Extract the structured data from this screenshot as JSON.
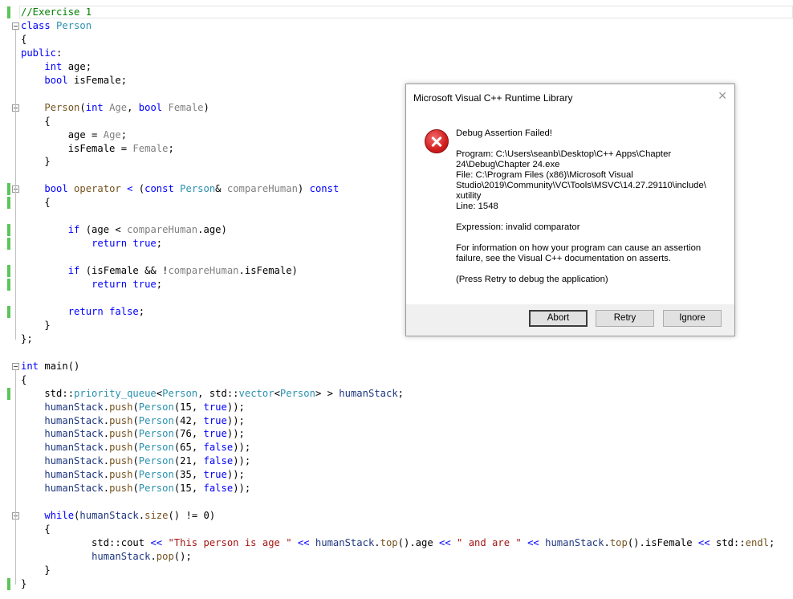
{
  "code": {
    "lines": [
      [
        [
          "cm",
          "//Exercise 1"
        ]
      ],
      [
        [
          "kw",
          "class "
        ],
        [
          "ty",
          "Person"
        ]
      ],
      [
        [
          "",
          "{"
        ]
      ],
      [
        [
          "kw",
          "public"
        ],
        [
          "",
          ":"
        ]
      ],
      [
        [
          "",
          "    "
        ],
        [
          "kw",
          "int "
        ],
        [
          "",
          "age;"
        ]
      ],
      [
        [
          "",
          "    "
        ],
        [
          "kw",
          "bool "
        ],
        [
          "",
          "isFemale;"
        ]
      ],
      [
        [
          "",
          ""
        ]
      ],
      [
        [
          "",
          "    "
        ],
        [
          "fn",
          "Person"
        ],
        [
          "",
          "("
        ],
        [
          "kw",
          "int "
        ],
        [
          "pa",
          "Age"
        ],
        [
          "",
          ", "
        ],
        [
          "kw",
          "bool "
        ],
        [
          "pa",
          "Female"
        ],
        [
          "",
          ")"
        ]
      ],
      [
        [
          "",
          "    {"
        ]
      ],
      [
        [
          "",
          "        age = "
        ],
        [
          "pa",
          "Age"
        ],
        [
          "",
          ";"
        ]
      ],
      [
        [
          "",
          "        isFemale = "
        ],
        [
          "pa",
          "Female"
        ],
        [
          "",
          ";"
        ]
      ],
      [
        [
          "",
          "    }"
        ]
      ],
      [
        [
          "",
          ""
        ]
      ],
      [
        [
          "",
          "    "
        ],
        [
          "kw",
          "bool "
        ],
        [
          "fn",
          "operator"
        ],
        [
          "",
          ""
        ],
        [
          "kw",
          " < "
        ],
        [
          "",
          "("
        ],
        [
          "kw",
          "const "
        ],
        [
          "ty",
          "Person"
        ],
        [
          "",
          "& "
        ],
        [
          "pa",
          "compareHuman"
        ],
        [
          "",
          ") "
        ],
        [
          "kw",
          "const"
        ]
      ],
      [
        [
          "",
          "    {"
        ]
      ],
      [
        [
          "",
          ""
        ]
      ],
      [
        [
          "",
          "        "
        ],
        [
          "kw",
          "if "
        ],
        [
          "",
          "(age < "
        ],
        [
          "pa",
          "compareHuman"
        ],
        [
          "",
          ".age)"
        ]
      ],
      [
        [
          "",
          "            "
        ],
        [
          "kw",
          "return true"
        ],
        [
          "",
          ";"
        ]
      ],
      [
        [
          "",
          ""
        ]
      ],
      [
        [
          "",
          "        "
        ],
        [
          "kw",
          "if "
        ],
        [
          "",
          "(isFemale && !"
        ],
        [
          "pa",
          "compareHuman"
        ],
        [
          "",
          ".isFemale)"
        ]
      ],
      [
        [
          "",
          "            "
        ],
        [
          "kw",
          "return true"
        ],
        [
          "",
          ";"
        ]
      ],
      [
        [
          "",
          ""
        ]
      ],
      [
        [
          "",
          "        "
        ],
        [
          "kw",
          "return false"
        ],
        [
          "",
          ";"
        ]
      ],
      [
        [
          "",
          "    }"
        ]
      ],
      [
        [
          "",
          "};"
        ]
      ],
      [
        [
          "",
          ""
        ]
      ],
      [
        [
          "kw",
          "int "
        ],
        [
          "",
          "main()"
        ]
      ],
      [
        [
          "",
          "{"
        ]
      ],
      [
        [
          "",
          "    std::"
        ],
        [
          "ty",
          "priority_queue"
        ],
        [
          "",
          "<"
        ],
        [
          "ty",
          "Person"
        ],
        [
          "",
          ", std::"
        ],
        [
          "ty",
          "vector"
        ],
        [
          "",
          "<"
        ],
        [
          "ty",
          "Person"
        ],
        [
          "",
          "> > "
        ],
        [
          "lo",
          "humanStack"
        ],
        [
          "",
          ";"
        ]
      ],
      [
        [
          "",
          "    "
        ],
        [
          "lo",
          "humanStack"
        ],
        [
          "",
          "."
        ],
        [
          "fn",
          "push"
        ],
        [
          "",
          "("
        ],
        [
          "ty",
          "Person"
        ],
        [
          "",
          "(15, "
        ],
        [
          "kw",
          "true"
        ],
        [
          "",
          "));"
        ]
      ],
      [
        [
          "",
          "    "
        ],
        [
          "lo",
          "humanStack"
        ],
        [
          "",
          "."
        ],
        [
          "fn",
          "push"
        ],
        [
          "",
          "("
        ],
        [
          "ty",
          "Person"
        ],
        [
          "",
          "(42, "
        ],
        [
          "kw",
          "true"
        ],
        [
          "",
          "));"
        ]
      ],
      [
        [
          "",
          "    "
        ],
        [
          "lo",
          "humanStack"
        ],
        [
          "",
          "."
        ],
        [
          "fn",
          "push"
        ],
        [
          "",
          "("
        ],
        [
          "ty",
          "Person"
        ],
        [
          "",
          "(76, "
        ],
        [
          "kw",
          "true"
        ],
        [
          "",
          "));"
        ]
      ],
      [
        [
          "",
          "    "
        ],
        [
          "lo",
          "humanStack"
        ],
        [
          "",
          "."
        ],
        [
          "fn",
          "push"
        ],
        [
          "",
          "("
        ],
        [
          "ty",
          "Person"
        ],
        [
          "",
          "(65, "
        ],
        [
          "kw",
          "false"
        ],
        [
          "",
          "));"
        ]
      ],
      [
        [
          "",
          "    "
        ],
        [
          "lo",
          "humanStack"
        ],
        [
          "",
          "."
        ],
        [
          "fn",
          "push"
        ],
        [
          "",
          "("
        ],
        [
          "ty",
          "Person"
        ],
        [
          "",
          "(21, "
        ],
        [
          "kw",
          "false"
        ],
        [
          "",
          "));"
        ]
      ],
      [
        [
          "",
          "    "
        ],
        [
          "lo",
          "humanStack"
        ],
        [
          "",
          "."
        ],
        [
          "fn",
          "push"
        ],
        [
          "",
          "("
        ],
        [
          "ty",
          "Person"
        ],
        [
          "",
          "(35, "
        ],
        [
          "kw",
          "true"
        ],
        [
          "",
          "));"
        ]
      ],
      [
        [
          "",
          "    "
        ],
        [
          "lo",
          "humanStack"
        ],
        [
          "",
          "."
        ],
        [
          "fn",
          "push"
        ],
        [
          "",
          "("
        ],
        [
          "ty",
          "Person"
        ],
        [
          "",
          "(15, "
        ],
        [
          "kw",
          "false"
        ],
        [
          "",
          "));"
        ]
      ],
      [
        [
          "",
          ""
        ]
      ],
      [
        [
          "",
          "    "
        ],
        [
          "kw",
          "while"
        ],
        [
          "",
          "("
        ],
        [
          "lo",
          "humanStack"
        ],
        [
          "",
          "."
        ],
        [
          "fn",
          "size"
        ],
        [
          "",
          "() != 0)"
        ]
      ],
      [
        [
          "",
          "    {"
        ]
      ],
      [
        [
          "",
          "            std::"
        ],
        [
          "",
          "cout "
        ],
        [
          "kw",
          "<< "
        ],
        [
          "st",
          "\"This person is age \" "
        ],
        [
          "kw",
          "<< "
        ],
        [
          "lo",
          "humanStack"
        ],
        [
          "",
          "."
        ],
        [
          "fn",
          "top"
        ],
        [
          "",
          "().age "
        ],
        [
          "kw",
          "<< "
        ],
        [
          "st",
          "\" and are \" "
        ],
        [
          "kw",
          "<< "
        ],
        [
          "lo",
          "humanStack"
        ],
        [
          "",
          "."
        ],
        [
          "fn",
          "top"
        ],
        [
          "",
          "().isFemale "
        ],
        [
          "kw",
          "<< "
        ],
        [
          "",
          "std::"
        ],
        [
          "fn",
          "endl"
        ],
        [
          "",
          ";"
        ]
      ],
      [
        [
          "",
          "            "
        ],
        [
          "lo",
          "humanStack"
        ],
        [
          "",
          "."
        ],
        [
          "fn",
          "pop"
        ],
        [
          "",
          "();"
        ]
      ],
      [
        [
          "",
          "    }"
        ]
      ],
      [
        [
          "",
          "}"
        ]
      ]
    ],
    "changed_lines": [
      0,
      13,
      14,
      16,
      17,
      19,
      20,
      22,
      28,
      42
    ],
    "fold_lines": [
      1,
      7,
      13,
      26,
      37
    ]
  },
  "dialog": {
    "title": "Microsoft Visual C++ Runtime Library",
    "close_glyph": "✕",
    "heading": "Debug Assertion Failed!",
    "program_line1": "Program: C:\\Users\\seanb\\Desktop\\C++ Apps\\Chapter",
    "program_line2": "24\\Debug\\Chapter 24.exe",
    "file_line1": "File: C:\\Program Files (x86)\\Microsoft Visual",
    "file_line2": "Studio\\2019\\Community\\VC\\Tools\\MSVC\\14.27.29110\\include\\",
    "file_line3": "xutility",
    "line_info": "Line: 1548",
    "expression": "Expression: invalid comparator",
    "info_line1": "For information on how your program can cause an assertion",
    "info_line2": "failure, see the Visual C++ documentation on asserts.",
    "retry_hint": "(Press Retry to debug the application)",
    "buttons": {
      "abort": "Abort",
      "retry": "Retry",
      "ignore": "Ignore"
    },
    "icon": "error-x-icon"
  }
}
